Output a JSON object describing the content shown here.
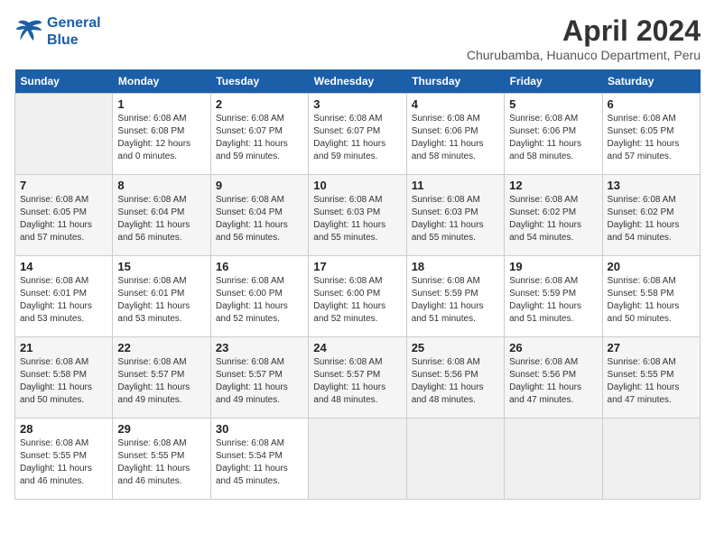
{
  "header": {
    "logo_line1": "General",
    "logo_line2": "Blue",
    "title": "April 2024",
    "subtitle": "Churubamba, Huanuco Department, Peru"
  },
  "weekdays": [
    "Sunday",
    "Monday",
    "Tuesday",
    "Wednesday",
    "Thursday",
    "Friday",
    "Saturday"
  ],
  "weeks": [
    [
      {
        "day": "",
        "empty": true
      },
      {
        "day": "1",
        "sunrise": "Sunrise: 6:08 AM",
        "sunset": "Sunset: 6:08 PM",
        "daylight": "Daylight: 12 hours and 0 minutes."
      },
      {
        "day": "2",
        "sunrise": "Sunrise: 6:08 AM",
        "sunset": "Sunset: 6:07 PM",
        "daylight": "Daylight: 11 hours and 59 minutes."
      },
      {
        "day": "3",
        "sunrise": "Sunrise: 6:08 AM",
        "sunset": "Sunset: 6:07 PM",
        "daylight": "Daylight: 11 hours and 59 minutes."
      },
      {
        "day": "4",
        "sunrise": "Sunrise: 6:08 AM",
        "sunset": "Sunset: 6:06 PM",
        "daylight": "Daylight: 11 hours and 58 minutes."
      },
      {
        "day": "5",
        "sunrise": "Sunrise: 6:08 AM",
        "sunset": "Sunset: 6:06 PM",
        "daylight": "Daylight: 11 hours and 58 minutes."
      },
      {
        "day": "6",
        "sunrise": "Sunrise: 6:08 AM",
        "sunset": "Sunset: 6:05 PM",
        "daylight": "Daylight: 11 hours and 57 minutes."
      }
    ],
    [
      {
        "day": "7",
        "sunrise": "Sunrise: 6:08 AM",
        "sunset": "Sunset: 6:05 PM",
        "daylight": "Daylight: 11 hours and 57 minutes."
      },
      {
        "day": "8",
        "sunrise": "Sunrise: 6:08 AM",
        "sunset": "Sunset: 6:04 PM",
        "daylight": "Daylight: 11 hours and 56 minutes."
      },
      {
        "day": "9",
        "sunrise": "Sunrise: 6:08 AM",
        "sunset": "Sunset: 6:04 PM",
        "daylight": "Daylight: 11 hours and 56 minutes."
      },
      {
        "day": "10",
        "sunrise": "Sunrise: 6:08 AM",
        "sunset": "Sunset: 6:03 PM",
        "daylight": "Daylight: 11 hours and 55 minutes."
      },
      {
        "day": "11",
        "sunrise": "Sunrise: 6:08 AM",
        "sunset": "Sunset: 6:03 PM",
        "daylight": "Daylight: 11 hours and 55 minutes."
      },
      {
        "day": "12",
        "sunrise": "Sunrise: 6:08 AM",
        "sunset": "Sunset: 6:02 PM",
        "daylight": "Daylight: 11 hours and 54 minutes."
      },
      {
        "day": "13",
        "sunrise": "Sunrise: 6:08 AM",
        "sunset": "Sunset: 6:02 PM",
        "daylight": "Daylight: 11 hours and 54 minutes."
      }
    ],
    [
      {
        "day": "14",
        "sunrise": "Sunrise: 6:08 AM",
        "sunset": "Sunset: 6:01 PM",
        "daylight": "Daylight: 11 hours and 53 minutes."
      },
      {
        "day": "15",
        "sunrise": "Sunrise: 6:08 AM",
        "sunset": "Sunset: 6:01 PM",
        "daylight": "Daylight: 11 hours and 53 minutes."
      },
      {
        "day": "16",
        "sunrise": "Sunrise: 6:08 AM",
        "sunset": "Sunset: 6:00 PM",
        "daylight": "Daylight: 11 hours and 52 minutes."
      },
      {
        "day": "17",
        "sunrise": "Sunrise: 6:08 AM",
        "sunset": "Sunset: 6:00 PM",
        "daylight": "Daylight: 11 hours and 52 minutes."
      },
      {
        "day": "18",
        "sunrise": "Sunrise: 6:08 AM",
        "sunset": "Sunset: 5:59 PM",
        "daylight": "Daylight: 11 hours and 51 minutes."
      },
      {
        "day": "19",
        "sunrise": "Sunrise: 6:08 AM",
        "sunset": "Sunset: 5:59 PM",
        "daylight": "Daylight: 11 hours and 51 minutes."
      },
      {
        "day": "20",
        "sunrise": "Sunrise: 6:08 AM",
        "sunset": "Sunset: 5:58 PM",
        "daylight": "Daylight: 11 hours and 50 minutes."
      }
    ],
    [
      {
        "day": "21",
        "sunrise": "Sunrise: 6:08 AM",
        "sunset": "Sunset: 5:58 PM",
        "daylight": "Daylight: 11 hours and 50 minutes."
      },
      {
        "day": "22",
        "sunrise": "Sunrise: 6:08 AM",
        "sunset": "Sunset: 5:57 PM",
        "daylight": "Daylight: 11 hours and 49 minutes."
      },
      {
        "day": "23",
        "sunrise": "Sunrise: 6:08 AM",
        "sunset": "Sunset: 5:57 PM",
        "daylight": "Daylight: 11 hours and 49 minutes."
      },
      {
        "day": "24",
        "sunrise": "Sunrise: 6:08 AM",
        "sunset": "Sunset: 5:57 PM",
        "daylight": "Daylight: 11 hours and 48 minutes."
      },
      {
        "day": "25",
        "sunrise": "Sunrise: 6:08 AM",
        "sunset": "Sunset: 5:56 PM",
        "daylight": "Daylight: 11 hours and 48 minutes."
      },
      {
        "day": "26",
        "sunrise": "Sunrise: 6:08 AM",
        "sunset": "Sunset: 5:56 PM",
        "daylight": "Daylight: 11 hours and 47 minutes."
      },
      {
        "day": "27",
        "sunrise": "Sunrise: 6:08 AM",
        "sunset": "Sunset: 5:55 PM",
        "daylight": "Daylight: 11 hours and 47 minutes."
      }
    ],
    [
      {
        "day": "28",
        "sunrise": "Sunrise: 6:08 AM",
        "sunset": "Sunset: 5:55 PM",
        "daylight": "Daylight: 11 hours and 46 minutes."
      },
      {
        "day": "29",
        "sunrise": "Sunrise: 6:08 AM",
        "sunset": "Sunset: 5:55 PM",
        "daylight": "Daylight: 11 hours and 46 minutes."
      },
      {
        "day": "30",
        "sunrise": "Sunrise: 6:08 AM",
        "sunset": "Sunset: 5:54 PM",
        "daylight": "Daylight: 11 hours and 45 minutes."
      },
      {
        "day": "",
        "empty": true
      },
      {
        "day": "",
        "empty": true
      },
      {
        "day": "",
        "empty": true
      },
      {
        "day": "",
        "empty": true
      }
    ]
  ]
}
